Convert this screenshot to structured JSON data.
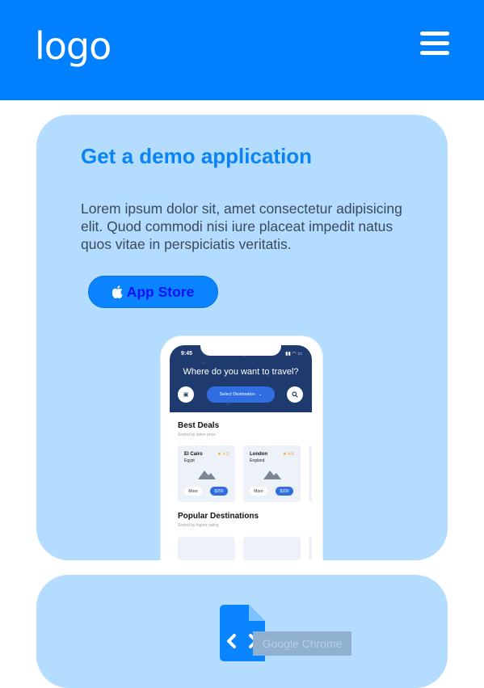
{
  "header": {
    "logo_text": "logo",
    "menu_icon": "hamburger-icon"
  },
  "demo": {
    "title": "Get a demo application",
    "description": "Lorem ipsum dolor sit, amet consectetur adipisicing elit. Quod commodi nisi iure placeat impedit natus quos vitae in perspiciatis veritatis.",
    "store_button": {
      "icon": "apple-icon",
      "label": "App Store"
    }
  },
  "phone": {
    "time": "9:45",
    "question": "Where do you want to travel?",
    "destination_pill": "Select Destination",
    "best_deals_title": "Best Deals",
    "best_deals_sub": "Sorted by lower price",
    "deals": [
      {
        "city": "El Cairo",
        "country": "Egypt",
        "rating": "★ 4.3",
        "more": "More",
        "price": "$250"
      },
      {
        "city": "London",
        "country": "England",
        "rating": "★ 4.6",
        "more": "More",
        "price": "$330"
      }
    ],
    "popular_title": "Popular Destinations",
    "popular_sub": "Sorted by higher rating"
  },
  "second_card": {
    "icon": "code-file-icon",
    "tooltip": "Google Chrome"
  },
  "colors": {
    "brand": "#0080ff",
    "card_bg": "#b3dcff",
    "title": "#0a84f5",
    "phone_dark": "#1e3a6e"
  }
}
